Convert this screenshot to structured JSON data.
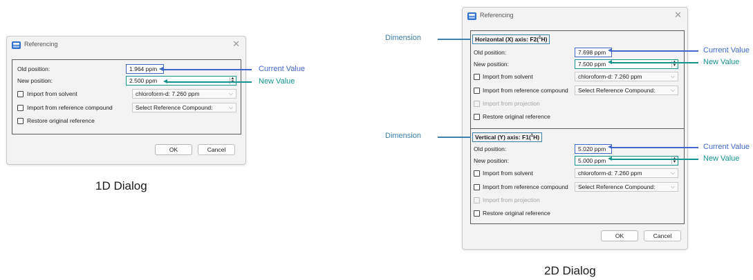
{
  "dialog_1d": {
    "title": "Referencing",
    "old_position_label": "Old position:",
    "old_position_value": "1.964 ppm",
    "new_position_label": "New position:",
    "new_position_value": "2.500 ppm",
    "import_solvent_label": "Import from solvent",
    "solvent_select": "chloroform-d: 7.260 ppm",
    "import_compound_label": "Import from reference compound",
    "compound_select": "Select Reference Compound:",
    "restore_label": "Restore original reference",
    "ok_label": "OK",
    "cancel_label": "Cancel"
  },
  "dialog_2d": {
    "title": "Referencing",
    "horizontal": {
      "axis_title_prefix": "Horizontal (X) axis: F2(",
      "axis_title_sup": "1",
      "axis_title_suffix": "H)",
      "old_position_label": "Old position:",
      "old_position_value": "7.698 ppm",
      "new_position_label": "New position:",
      "new_position_value": "7.500 ppm",
      "import_solvent_label": "Import from solvent",
      "solvent_select": "chloroform-d: 7.260 ppm",
      "import_compound_label": "Import from reference compound",
      "compound_select": "Select Reference Compound:",
      "projection_label": "Import from projection",
      "restore_label": "Restore original reference"
    },
    "vertical": {
      "axis_title_prefix": "Vertical (Y) axis: F1(",
      "axis_title_sup": "1",
      "axis_title_suffix": "H)",
      "old_position_label": "Old position:",
      "old_position_value": "5.020 ppm",
      "new_position_label": "New position:",
      "new_position_value": "5.000 ppm",
      "import_solvent_label": "Import from solvent",
      "solvent_select": "chloroform-d: 7.260 ppm",
      "import_compound_label": "Import from reference compound",
      "compound_select": "Select Reference Compound:",
      "projection_label": "Import from projection",
      "restore_label": "Restore original reference"
    },
    "ok_label": "OK",
    "cancel_label": "Cancel"
  },
  "annotations": {
    "current_value": "Current Value",
    "new_value": "New Value",
    "dimension": "Dimension",
    "caption_1d": "1D Dialog",
    "caption_2d": "2D Dialog"
  },
  "colors": {
    "current_value": "#3f66c9",
    "new_value": "#13938f",
    "dimension": "#3b7fae"
  },
  "icons": {
    "app": "referencing-app-icon",
    "close": "close-icon",
    "spin": "spin-arrows-icon",
    "dropdown": "chevron-down-icon"
  }
}
